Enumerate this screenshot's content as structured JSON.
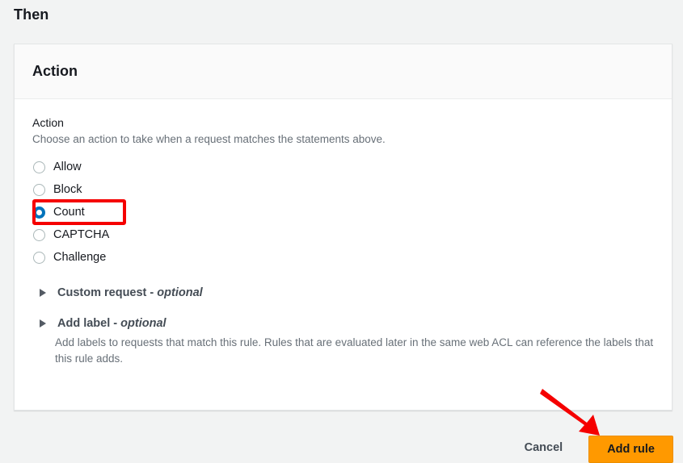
{
  "page": {
    "section_heading": "Then"
  },
  "card": {
    "header_title": "Action",
    "field": {
      "label": "Action",
      "description": "Choose an action to take when a request matches the statements above."
    },
    "radio_options": [
      {
        "label": "Allow",
        "checked": false
      },
      {
        "label": "Block",
        "checked": false
      },
      {
        "label": "Count",
        "checked": true
      },
      {
        "label": "CAPTCHA",
        "checked": false
      },
      {
        "label": "Challenge",
        "checked": false
      }
    ],
    "expandables": [
      {
        "title": "Custom request",
        "separator": " - ",
        "optional": "optional",
        "description": ""
      },
      {
        "title": "Add label",
        "separator": " - ",
        "optional": "optional",
        "description": "Add labels to requests that match this rule. Rules that are evaluated later in the same web ACL can reference the labels that this rule adds."
      }
    ]
  },
  "footer": {
    "cancel_label": "Cancel",
    "submit_label": "Add rule"
  },
  "annotations": {
    "highlight_target": "Count",
    "arrow_target": "Add rule",
    "color": "#f50000"
  },
  "colors": {
    "page_background": "#f2f3f3",
    "card_background": "#ffffff",
    "card_header_background": "#fafafa",
    "primary_button": "#ff9900",
    "radio_selected": "#0073bb",
    "annotation_red": "#f50000",
    "text_primary": "#16191f",
    "text_secondary": "#687078"
  }
}
